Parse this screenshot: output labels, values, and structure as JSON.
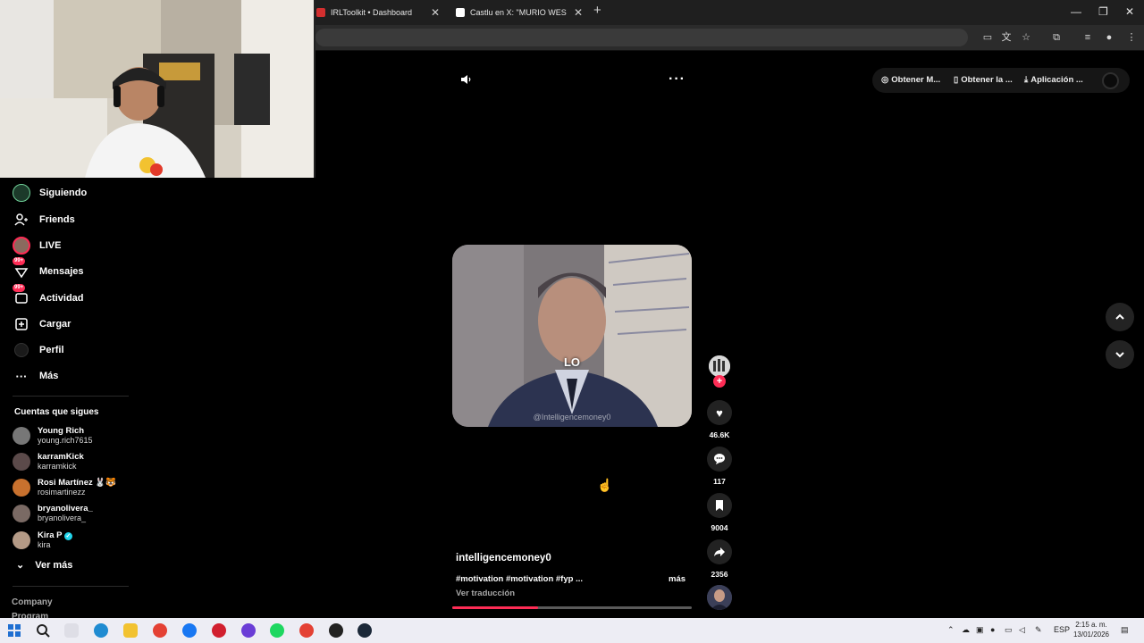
{
  "browser": {
    "tabs": [
      {
        "label": "IRLToolkit • Dashboard",
        "favicon_color": "#d32f2f"
      },
      {
        "label": "Castlu en X: \"MURIO WESTCOL",
        "favicon_color": "#ffffff"
      }
    ],
    "new_tab_symbol": "+",
    "tab_close_symbol": "✕",
    "window": {
      "minimize": "—",
      "restore": "❐",
      "close": "✕"
    }
  },
  "sidebar": {
    "items": [
      {
        "label": "Siguiendo",
        "icon": "following-avatar-icon"
      },
      {
        "label": "Friends",
        "icon": "friends-icon"
      },
      {
        "label": "LIVE",
        "icon": "live-avatar-icon"
      },
      {
        "label": "Mensajes",
        "icon": "messages-icon",
        "badge": "99+"
      },
      {
        "label": "Actividad",
        "icon": "activity-icon",
        "badge": "99+"
      },
      {
        "label": "Cargar",
        "icon": "upload-icon"
      },
      {
        "label": "Perfil",
        "icon": "profile-icon"
      },
      {
        "label": "Más",
        "icon": "more-icon"
      }
    ],
    "following_title": "Cuentas que sigues",
    "following": [
      {
        "name": "Young Rich",
        "handle": "young.rich7615",
        "avatar_color": "#777"
      },
      {
        "name": "karramKick",
        "handle": "karramkick",
        "avatar_color": "#5b4a4a"
      },
      {
        "name": "Rosi Martínez 🐰🐯",
        "handle": "rosimartinezz",
        "avatar_color": "#c8712e"
      },
      {
        "name": "bryanolivera_",
        "handle": "bryanolivera_",
        "avatar_color": "#7a6a64"
      },
      {
        "name": "Kira P",
        "handle": "kira",
        "avatar_color": "#b49a86"
      }
    ],
    "see_more": "Ver más",
    "footer": {
      "company": "Company",
      "program": "Program"
    }
  },
  "topbar": {
    "get_m": "Obtener M...",
    "get_la": "Obtener la ...",
    "app": "Aplicación ..."
  },
  "video": {
    "subtitle": "LO",
    "watermark": "@Intelligencemoney0",
    "progress": 0.36
  },
  "actions": {
    "likes": "46.6K",
    "comments": "117",
    "saves": "9004",
    "shares": "2356"
  },
  "caption": {
    "username": "intelligencemoney0",
    "hashtags": "#motivation #motivation #fyp ...",
    "more": "más",
    "translate": "Ver traducción"
  },
  "taskbar": {
    "language": "ESP",
    "time": "2:15 a. m.",
    "date": "13/01/2026"
  },
  "colors": {
    "accent": "#fe2c55",
    "background": "#000000"
  }
}
